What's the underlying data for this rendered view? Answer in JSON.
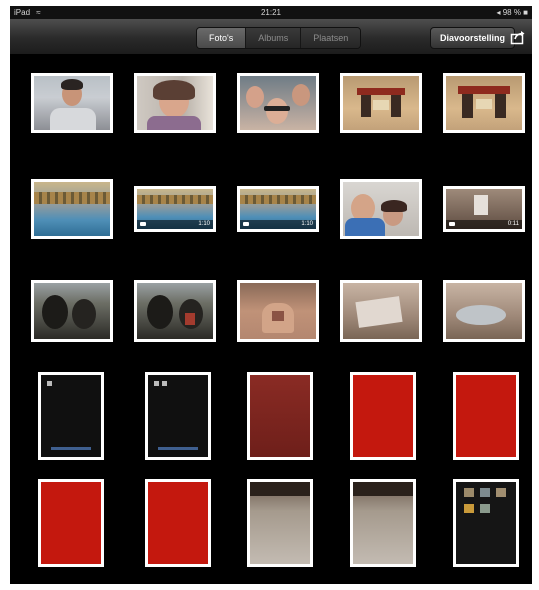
{
  "status_bar": {
    "carrier": "iPad",
    "wifi_icon": "wifi-icon",
    "time": "21:21",
    "right": "◂ 98 % ■"
  },
  "toolbar": {
    "tabs": [
      {
        "label": "Foto's",
        "active": true
      },
      {
        "label": "Albums",
        "active": false
      },
      {
        "label": "Plaatsen",
        "active": false
      }
    ],
    "slideshow_label": "Diavoorstelling",
    "share_icon": "share-icon"
  },
  "thumbnails": [
    {
      "kind": "photo",
      "subject": "boy-portrait"
    },
    {
      "kind": "photo",
      "subject": "girl-smiling"
    },
    {
      "kind": "photo",
      "subject": "family-selfie"
    },
    {
      "kind": "photo",
      "subject": "lego-gate"
    },
    {
      "kind": "photo",
      "subject": "lego-gate"
    },
    {
      "kind": "photo",
      "subject": "pool"
    },
    {
      "kind": "video",
      "subject": "pool",
      "duration": "1:10"
    },
    {
      "kind": "video",
      "subject": "pool",
      "duration": "1:10"
    },
    {
      "kind": "photo",
      "subject": "couple-selfie"
    },
    {
      "kind": "video",
      "subject": "room",
      "duration": "0:11"
    },
    {
      "kind": "photo",
      "subject": "people-silhouettes"
    },
    {
      "kind": "photo",
      "subject": "people-silhouettes"
    },
    {
      "kind": "photo",
      "subject": "person-back"
    },
    {
      "kind": "photo",
      "subject": "table"
    },
    {
      "kind": "photo",
      "subject": "table"
    },
    {
      "kind": "screenshot",
      "subject": "black-screen"
    },
    {
      "kind": "screenshot",
      "subject": "black-screen"
    },
    {
      "kind": "screenshot",
      "subject": "dark-red-screen"
    },
    {
      "kind": "screenshot",
      "subject": "red-screen"
    },
    {
      "kind": "screenshot",
      "subject": "red-screen"
    },
    {
      "kind": "screenshot",
      "subject": "red-screen"
    },
    {
      "kind": "screenshot",
      "subject": "red-screen"
    },
    {
      "kind": "screenshot",
      "subject": "room-screen"
    },
    {
      "kind": "screenshot",
      "subject": "room-screen"
    },
    {
      "kind": "screenshot",
      "subject": "home-screen-icons"
    }
  ],
  "colors": {
    "background": "#000000",
    "toolbar": "#2a2a2a",
    "red_screen": "#c4180e"
  }
}
